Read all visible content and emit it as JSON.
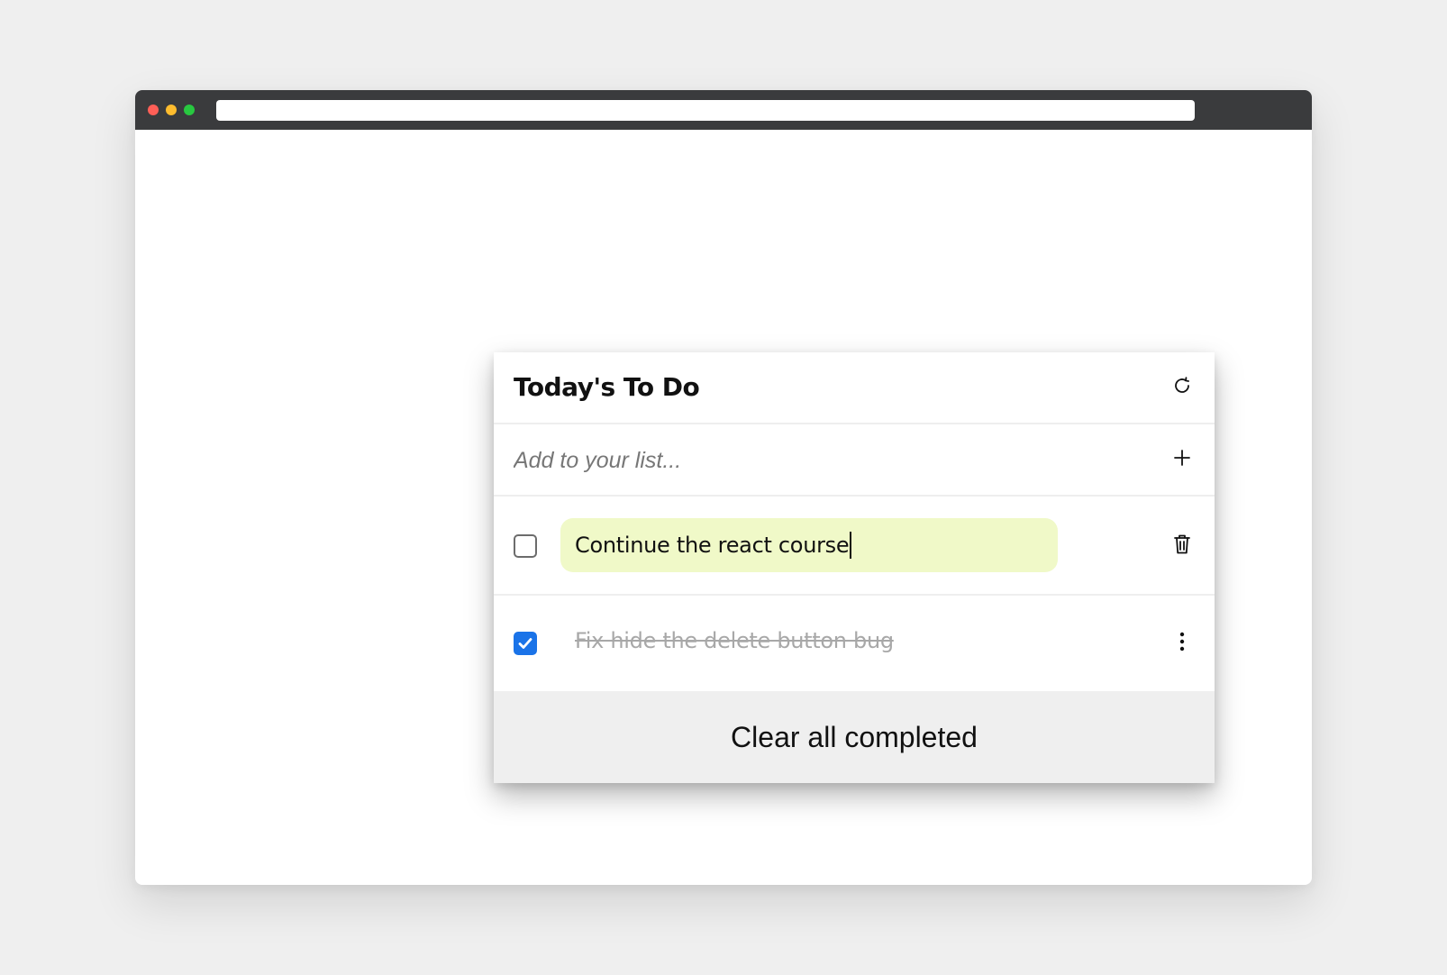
{
  "browser": {
    "address_value": "",
    "traffic_colors": {
      "close": "#ff5f57",
      "minimize": "#febc2e",
      "maximize": "#28c840"
    }
  },
  "todo": {
    "title": "Today's To Do",
    "refresh_icon": "refresh-icon",
    "add": {
      "placeholder": "Add to your list...",
      "icon": "plus-icon"
    },
    "items": [
      {
        "text": "Continue the react course",
        "completed": false,
        "editing": true,
        "action_icon": "trash-icon"
      },
      {
        "text": "Fix hide the delete button bug",
        "completed": true,
        "editing": false,
        "action_icon": "more-vertical-icon"
      }
    ],
    "clear_label": "Clear all completed"
  },
  "colors": {
    "accent": "#1a73e8",
    "edit_highlight": "#f0f9c8",
    "completed_text": "#a8a8a8",
    "footer_bg": "#efefef"
  }
}
